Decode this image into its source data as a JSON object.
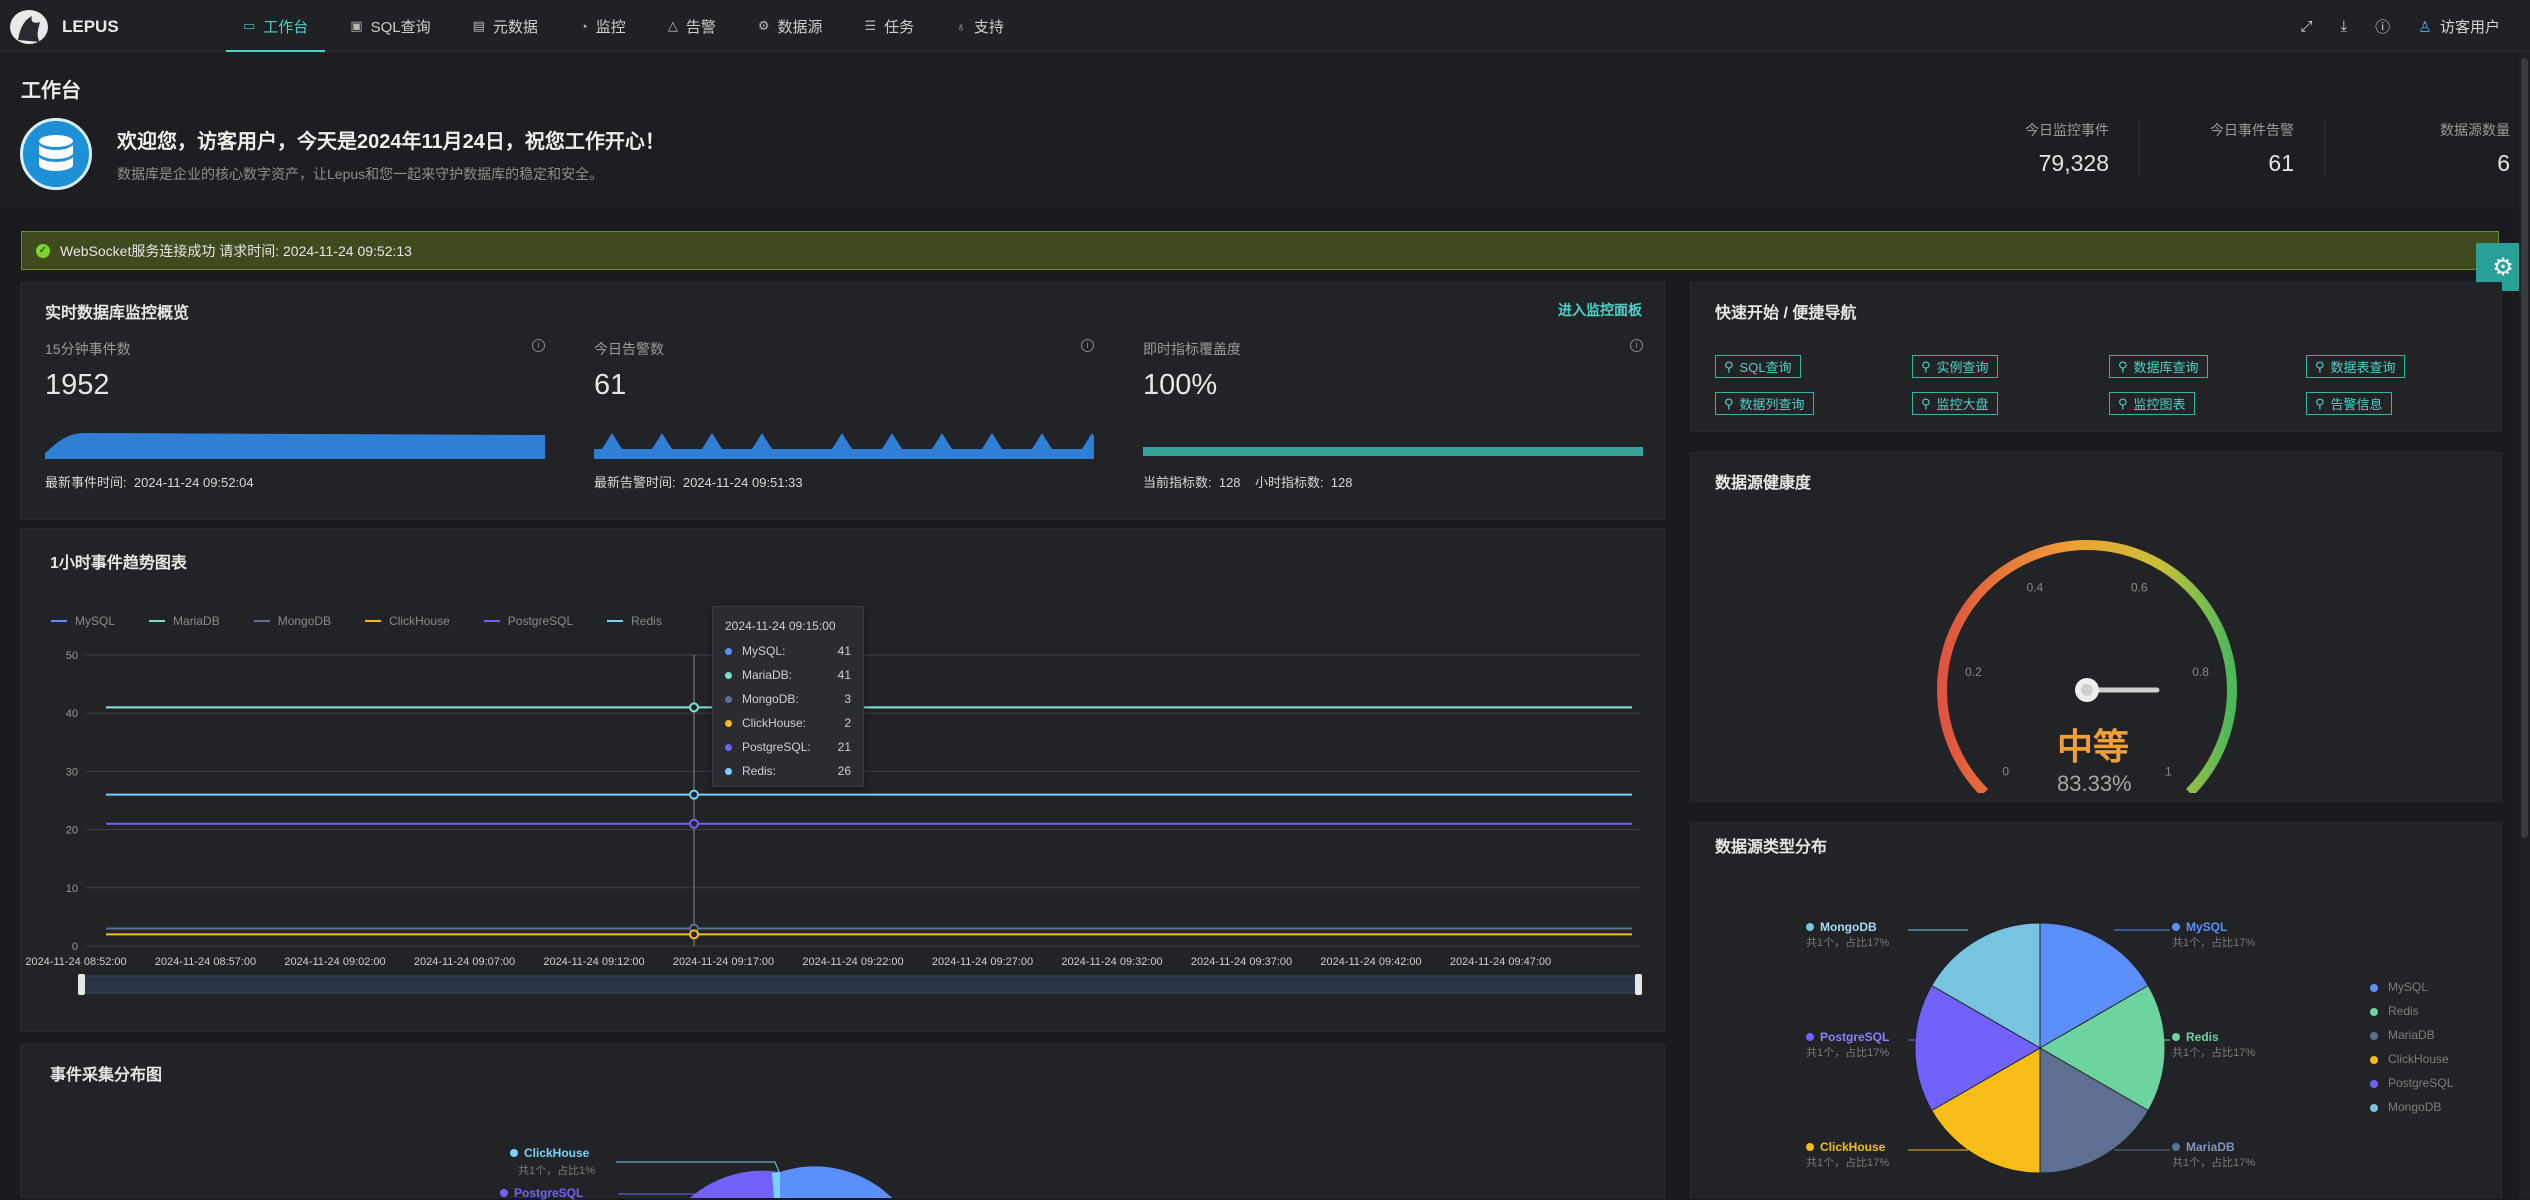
{
  "app": {
    "brand": "LEPUS"
  },
  "nav": [
    {
      "label": "工作台",
      "icon": "monitor-icon",
      "active": true
    },
    {
      "label": "SQL查询",
      "icon": "terminal-icon"
    },
    {
      "label": "元数据",
      "icon": "file-icon"
    },
    {
      "label": "监控",
      "icon": "gauge-icon"
    },
    {
      "label": "告警",
      "icon": "warning-icon"
    },
    {
      "label": "数据源",
      "icon": "gear-icon"
    },
    {
      "label": "任务",
      "icon": "list-icon"
    },
    {
      "label": "支持",
      "icon": "bulb-icon"
    }
  ],
  "topright": {
    "user": "访客用户"
  },
  "page": {
    "title": "工作台",
    "welcome": "欢迎您，访客用户，今天是2024年11月24日，祝您工作开心！",
    "subtitle": "数据库是企业的核心数字资产，让Lepus和您一起来守护数据库的稳定和安全。",
    "stats": [
      {
        "label": "今日监控事件",
        "value": "79,328"
      },
      {
        "label": "今日事件告警",
        "value": "61"
      },
      {
        "label": "数据源数量",
        "value": "6"
      }
    ]
  },
  "alert": {
    "text": "WebSocket服务连接成功 请求时间: 2024-11-24 09:52:13"
  },
  "overview": {
    "title": "实时数据库监控概览",
    "link": "进入监控面板",
    "cards": [
      {
        "label": "15分钟事件数",
        "value": "1952",
        "footer": "最新事件时间:  2024-11-24 09:52:04"
      },
      {
        "label": "今日告警数",
        "value": "61",
        "footer": "最新告警时间:  2024-11-24 09:51:33"
      },
      {
        "label": "即时指标覆盖度",
        "value": "100%",
        "footer": "当前指标数:  128    小时指标数:  128",
        "progress": 1.0
      }
    ]
  },
  "quick": {
    "title": "快速开始 / 便捷导航",
    "links": [
      "SQL查询",
      "实例查询",
      "数据库查询",
      "数据表查询",
      "数据列查询",
      "监控大盘",
      "监控图表",
      "告警信息"
    ]
  },
  "health": {
    "title": "数据源健康度",
    "level": "中等",
    "percent": "83.33%",
    "value": 0.8333,
    "ticks": [
      "0",
      "0.2",
      "0.4",
      "0.6",
      "0.8",
      "1"
    ]
  },
  "trend": {
    "title": "1小时事件趋势图表",
    "tooltip": {
      "time": "2024-11-24 09:15:00",
      "rows": [
        {
          "name": "MySQL:",
          "value": "41"
        },
        {
          "name": "MariaDB:",
          "value": "41"
        },
        {
          "name": "MongoDB:",
          "value": "3"
        },
        {
          "name": "ClickHouse:",
          "value": "2"
        },
        {
          "name": "PostgreSQL:",
          "value": "21"
        },
        {
          "name": "Redis:",
          "value": "26"
        }
      ]
    }
  },
  "chart_data": [
    {
      "type": "line",
      "title": "1小时事件趋势图表",
      "x": [
        "2024-11-24 08:52:00",
        "2024-11-24 08:57:00",
        "2024-11-24 09:02:00",
        "2024-11-24 09:07:00",
        "2024-11-24 09:12:00",
        "2024-11-24 09:17:00",
        "2024-11-24 09:22:00",
        "2024-11-24 09:27:00",
        "2024-11-24 09:32:00",
        "2024-11-24 09:37:00",
        "2024-11-24 09:42:00",
        "2024-11-24 09:47:00"
      ],
      "yticks": [
        "0",
        "10",
        "20",
        "30",
        "40",
        "50"
      ],
      "ylim": [
        0,
        50
      ],
      "legend": "top-left",
      "series": [
        {
          "name": "MySQL",
          "color": "#5b8ff9",
          "values": [
            41,
            41,
            41,
            41,
            41,
            41,
            41,
            41,
            41,
            41,
            41,
            41
          ]
        },
        {
          "name": "MariaDB",
          "color": "#7be0c8",
          "values": [
            41,
            41,
            41,
            41,
            41,
            41,
            41,
            41,
            41,
            41,
            41,
            41
          ]
        },
        {
          "name": "MongoDB",
          "color": "#5d7092",
          "values": [
            3,
            3,
            3,
            3,
            3,
            3,
            3,
            3,
            3,
            3,
            3,
            3
          ]
        },
        {
          "name": "ClickHouse",
          "color": "#f6bd16",
          "values": [
            2,
            2,
            2,
            2,
            2,
            2,
            2,
            2,
            2,
            2,
            2,
            2
          ]
        },
        {
          "name": "PostgreSQL",
          "color": "#7262fd",
          "values": [
            21,
            21,
            21,
            21,
            21,
            21,
            21,
            21,
            21,
            21,
            21,
            21
          ]
        },
        {
          "name": "Redis",
          "color": "#78d3f8",
          "values": [
            26,
            26,
            26,
            26,
            26,
            26,
            26,
            26,
            26,
            26,
            26,
            26
          ]
        }
      ]
    },
    {
      "type": "pie",
      "title": "数据源类型分布",
      "slices": [
        {
          "name": "MySQL",
          "value": 1,
          "color": "#5b8ff9",
          "note": "共1个，占比17%"
        },
        {
          "name": "Redis",
          "value": 1,
          "color": "#6dd3a0",
          "note": "共1个，占比17%"
        },
        {
          "name": "MariaDB",
          "value": 1,
          "color": "#5d7092",
          "note": "共1个，占比17%"
        },
        {
          "name": "ClickHouse",
          "value": 1,
          "color": "#f6bd16",
          "note": "共1个，占比17%"
        },
        {
          "name": "PostgreSQL",
          "value": 1,
          "color": "#7262fd",
          "note": "共1个，占比17%"
        },
        {
          "name": "MongoDB",
          "value": 1,
          "color": "#78c3e0",
          "note": "共1个，占比17%"
        }
      ],
      "legend": "right"
    }
  ],
  "dist": {
    "title": "事件采集分布图",
    "labels": [
      {
        "name": "ClickHouse",
        "note": "共1个，占比1%"
      },
      {
        "name": "PostgreSQL"
      }
    ]
  }
}
